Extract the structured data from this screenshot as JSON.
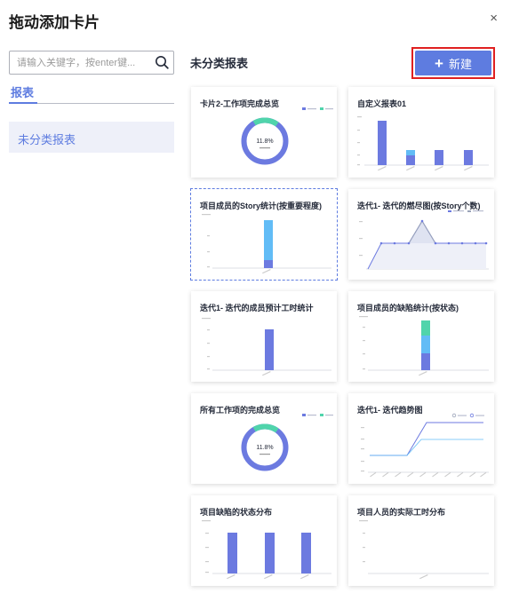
{
  "dialog": {
    "title": "拖动添加卡片",
    "close_label": "×"
  },
  "sidebar": {
    "search_placeholder": "请输入关键字，按enter键...",
    "tab_label": "报表",
    "items": [
      {
        "label": "未分类报表"
      }
    ]
  },
  "main": {
    "section_title": "未分类报表",
    "new_button_label": "新建",
    "cards": [
      {
        "title": "卡片2-工作项完成总览"
      },
      {
        "title": "自定义报表01"
      },
      {
        "title": "项目成员的Story统计(按重要程度)"
      },
      {
        "title": "迭代1- 迭代的燃尽图(按Story个数)"
      },
      {
        "title": "迭代1- 迭代的成员预计工时统计"
      },
      {
        "title": "项目成员的缺陷统计(按状态)"
      },
      {
        "title": "所有工作项的完成总览"
      },
      {
        "title": "迭代1- 迭代趋势图"
      },
      {
        "title": "项目缺陷的状态分布"
      },
      {
        "title": "项目人员的实际工时分布"
      }
    ],
    "donut_center_value": "11.8%"
  },
  "colors": {
    "accent": "#5e7ce0",
    "accent_dark": "#6c7ae0",
    "teal": "#50d4ab",
    "sky": "#62bcf6",
    "highlight_border": "#e02020"
  }
}
